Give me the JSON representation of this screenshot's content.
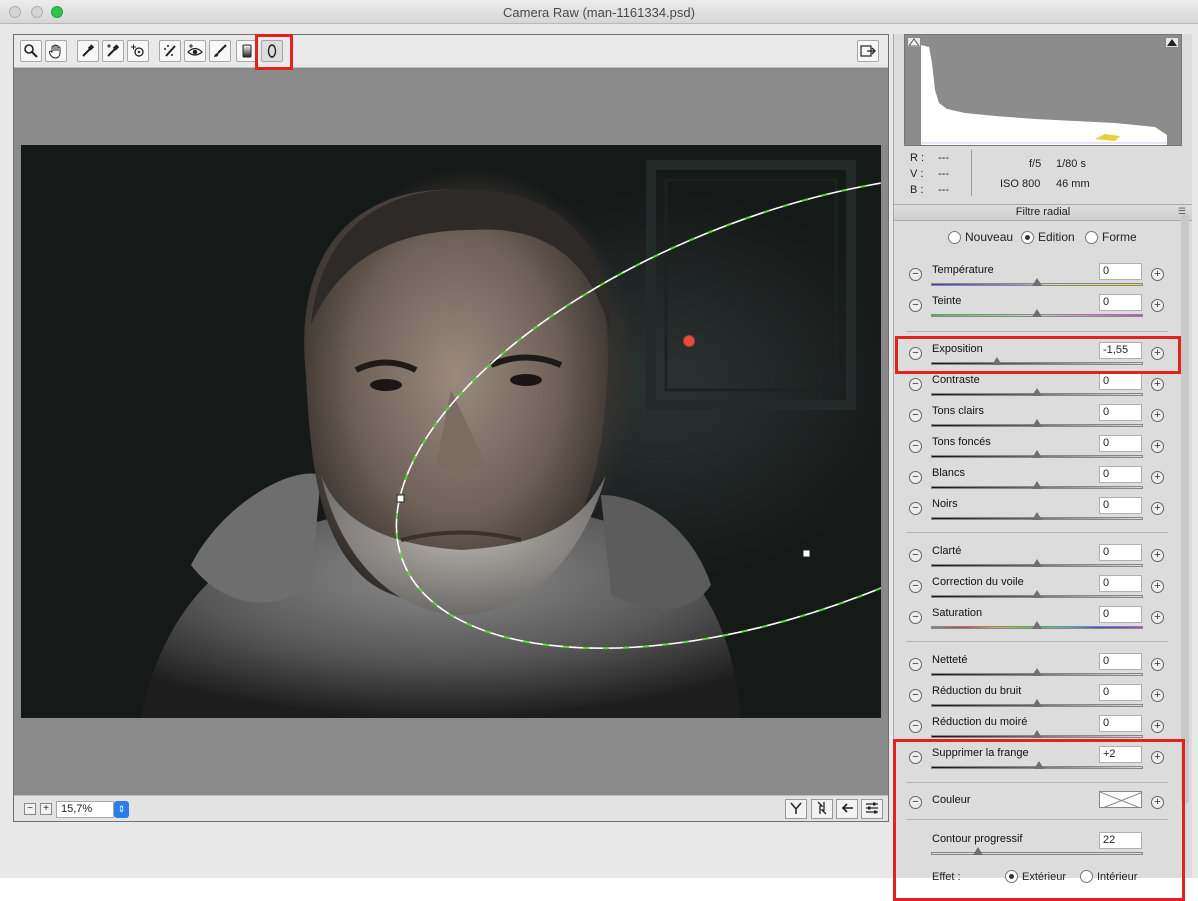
{
  "window": {
    "title": "Camera Raw (man-1161334.psd)"
  },
  "toolbar": {
    "tools": [
      {
        "name": "zoom-tool",
        "icon": "magnifier-icon"
      },
      {
        "name": "hand-tool",
        "icon": "hand-icon"
      },
      {
        "name": "white-balance-tool",
        "icon": "eyedropper-icon"
      },
      {
        "name": "color-sampler-tool",
        "icon": "eyedropper-plus-icon"
      },
      {
        "name": "targeted-adjustment-tool",
        "icon": "target-icon"
      },
      {
        "name": "spot-removal-tool",
        "icon": "spot-brush-icon"
      },
      {
        "name": "red-eye-tool",
        "icon": "eye-icon"
      },
      {
        "name": "adjustment-brush-tool",
        "icon": "brush-icon"
      },
      {
        "name": "graduated-filter-tool",
        "icon": "gradient-icon"
      },
      {
        "name": "radial-filter-tool",
        "icon": "ellipse-icon",
        "active": true
      }
    ]
  },
  "zoom": {
    "value": "15,7%"
  },
  "histogram": {
    "r_label": "R :",
    "r_value": "---",
    "v_label": "V :",
    "v_value": "---",
    "b_label": "B :",
    "b_value": "---",
    "aperture": "f/5",
    "shutter": "1/80 s",
    "iso": "ISO 800",
    "focal": "46 mm"
  },
  "panel": {
    "title": "Filtre radial",
    "mode_options": [
      "Nouveau",
      "Edition",
      "Forme"
    ],
    "mode_selected": "Edition"
  },
  "sliders": [
    {
      "label": "Température",
      "value": "0",
      "position": 0.5,
      "track": "temperature"
    },
    {
      "label": "Teinte",
      "value": "0",
      "position": 0.5,
      "track": "tint"
    },
    {
      "label": "Exposition",
      "value": "-1,55",
      "position": 0.31,
      "track": "gray"
    },
    {
      "label": "Contraste",
      "value": "0",
      "position": 0.5,
      "track": "gray"
    },
    {
      "label": "Tons clairs",
      "value": "0",
      "position": 0.5,
      "track": "gray"
    },
    {
      "label": "Tons foncés",
      "value": "0",
      "position": 0.5,
      "track": "gray"
    },
    {
      "label": "Blancs",
      "value": "0",
      "position": 0.5,
      "track": "gray"
    },
    {
      "label": "Noirs",
      "value": "0",
      "position": 0.5,
      "track": "gray"
    },
    {
      "label": "Clarté",
      "value": "0",
      "position": 0.5,
      "track": "gray"
    },
    {
      "label": "Correction du voile",
      "value": "0",
      "position": 0.5,
      "track": "gray"
    },
    {
      "label": "Saturation",
      "value": "0",
      "position": 0.5,
      "track": "saturation"
    },
    {
      "label": "Netteté",
      "value": "0",
      "position": 0.5,
      "track": "gray"
    },
    {
      "label": "Réduction du bruit",
      "value": "0",
      "position": 0.5,
      "track": "gray"
    },
    {
      "label": "Réduction du moiré",
      "value": "0",
      "position": 0.5,
      "track": "gray"
    },
    {
      "label": "Supprimer la frange",
      "value": "+2",
      "position": 0.51,
      "track": "gray"
    }
  ],
  "couleur": {
    "label": "Couleur"
  },
  "feather": {
    "label": "Contour progressif",
    "value": "22",
    "position": 0.22
  },
  "effect": {
    "label": "Effet :",
    "options": [
      "Extérieur",
      "Intérieur"
    ],
    "selected": "Extérieur"
  },
  "colors": {
    "highlight": "#e0231c",
    "pin": "#e74c3c",
    "radial_outline_green": "#5ad63a",
    "zoom_accent": "#2b7de9"
  }
}
